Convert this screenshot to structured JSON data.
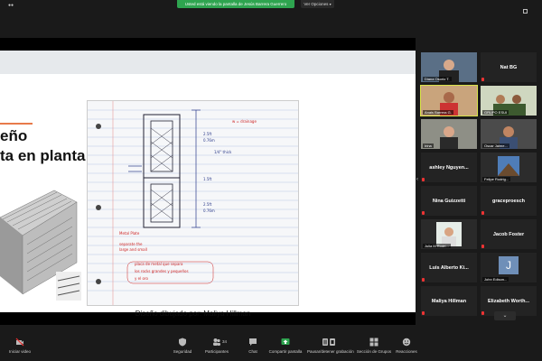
{
  "top": {
    "share_banner": "Usted está viendo la pantalla de Jesús Barrera Guerrero",
    "view_options": "Ver Opciones"
  },
  "slide": {
    "title_line1": "eño",
    "title_line2": "ta en planta",
    "caption": "Diseño dibujado por: Maliya Hillman"
  },
  "gallery": {
    "tiles": [
      {
        "name": "Diana Osorio",
        "label": "Diana Osorio T.",
        "has_video": true
      },
      {
        "name": "Nat BG",
        "label": "",
        "has_video": false
      },
      {
        "name": "Anais Barrera",
        "label": "Anais Barrera G.",
        "has_video": true
      },
      {
        "name": "GRUPO ESUI",
        "label": "GRUPO ESUI",
        "has_video": true
      },
      {
        "name": "Irina",
        "label": "Irina",
        "has_video": true
      },
      {
        "name": "Oscar Jaime",
        "label": "Oscar Jaime...",
        "has_video": true
      },
      {
        "name": "ashley Nguyen...",
        "label": "",
        "has_video": false
      },
      {
        "name": "Felipe Rodriguez",
        "label": "Felipe Rodrig...",
        "has_video": true
      },
      {
        "name": "Nina Guizzetti",
        "label": "",
        "has_video": false
      },
      {
        "name": "graceproesch",
        "label": "",
        "has_video": false
      },
      {
        "name": "Julia M Rodri",
        "label": "Julia M Rodri...",
        "has_video": true
      },
      {
        "name": "Jacob Foster",
        "label": "",
        "has_video": false
      },
      {
        "name": "Luis Alberto Ki...",
        "label": "",
        "has_video": false
      },
      {
        "name": "John Edison",
        "label": "John Edison...",
        "has_video": true,
        "avatar": "J"
      },
      {
        "name": "Maliya Hillman",
        "label": "",
        "has_video": false
      },
      {
        "name": "Elizabeth Worth...",
        "label": "",
        "has_video": false
      }
    ]
  },
  "toolbar": {
    "start_video": "Iniciar video",
    "security": "Seguridad",
    "participants": "Participantes",
    "participant_count": "34",
    "chat": "Chat",
    "share_screen": "Compartir pantalla",
    "pause_recording": "Pausar/detener grabación",
    "breakout_rooms": "Sección de Grupos",
    "reactions": "Reacciones"
  },
  "colors": {
    "share_banner": "#2ea44f",
    "active_speaker": "#d9e34a",
    "muted_mic": "#e33333",
    "slide_accent": "#e87a4a"
  }
}
